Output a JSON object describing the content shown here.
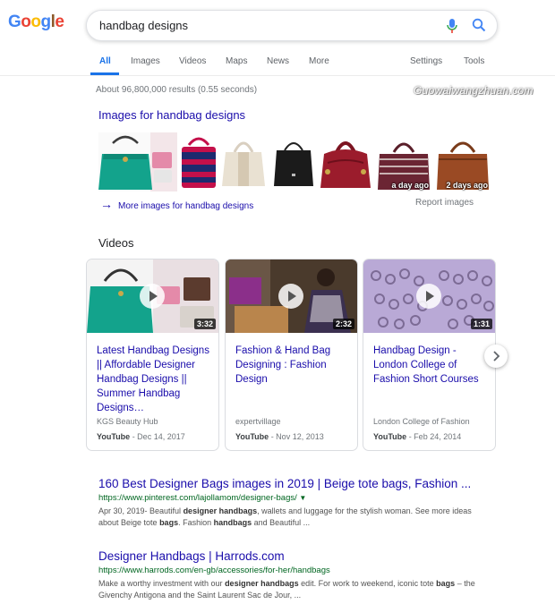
{
  "header": {
    "logo_text": "Google",
    "query": "handbag designs",
    "tabs": [
      {
        "label": "All",
        "active": true
      },
      {
        "label": "Images"
      },
      {
        "label": "Videos"
      },
      {
        "label": "Maps"
      },
      {
        "label": "News"
      },
      {
        "label": "More"
      },
      {
        "label": "Settings"
      },
      {
        "label": "Tools"
      }
    ]
  },
  "stats": "About 96,800,000 results (0.55 seconds)",
  "watermark": "Guowaiwangzhuan.com",
  "images_section": {
    "title": "Images for handbag designs",
    "badges": [
      "a day ago",
      "2 days ago"
    ],
    "more_link": "More images for handbag designs",
    "report": "Report images"
  },
  "videos_section": {
    "title": "Videos",
    "cards": [
      {
        "duration": "3:32",
        "title": "Latest Handbag Designs || Affordable Designer Handbag Designs || Summer Handbag Designs…",
        "source": "KGS Beauty Hub",
        "platform": "YouTube",
        "date": "- Dec 14, 2017"
      },
      {
        "duration": "2:32",
        "title": "Fashion & Hand Bag Designing : Fashion Design",
        "source": "expertvillage",
        "platform": "YouTube",
        "date": "- Nov 12, 2013"
      },
      {
        "duration": "1:31",
        "title": "Handbag Design - London College of Fashion Short Courses",
        "source": "London College of Fashion",
        "platform": "YouTube",
        "date": "- Feb 24, 2014"
      }
    ]
  },
  "results": [
    {
      "title": "160 Best Designer Bags images in 2019 | Beige tote bags, Fashion ...",
      "url": "https://www.pinterest.com/lajollamom/designer-bags/",
      "snippet_parts": [
        "Apr 30, 2019- Beautiful ",
        "designer handbags",
        ", wallets and luggage for the stylish woman. See more ideas about Beige tote ",
        "bags",
        ". Fashion ",
        "handbags",
        " and Beautiful ..."
      ]
    },
    {
      "title": "Designer Handbags | Harrods.com",
      "url": "https://www.harrods.com/en-gb/accessories/for-her/handbags",
      "snippet_parts": [
        "Make a worthy investment with our ",
        "designer handbags",
        " edit. For work to weekend, iconic tote ",
        "bags",
        " – the Givenchy Antigona and the Saint Laurent Sac de Jour, ..."
      ]
    }
  ],
  "colors": {
    "link": "#1a0dab",
    "accent": "#1a73e8",
    "url": "#006621"
  }
}
